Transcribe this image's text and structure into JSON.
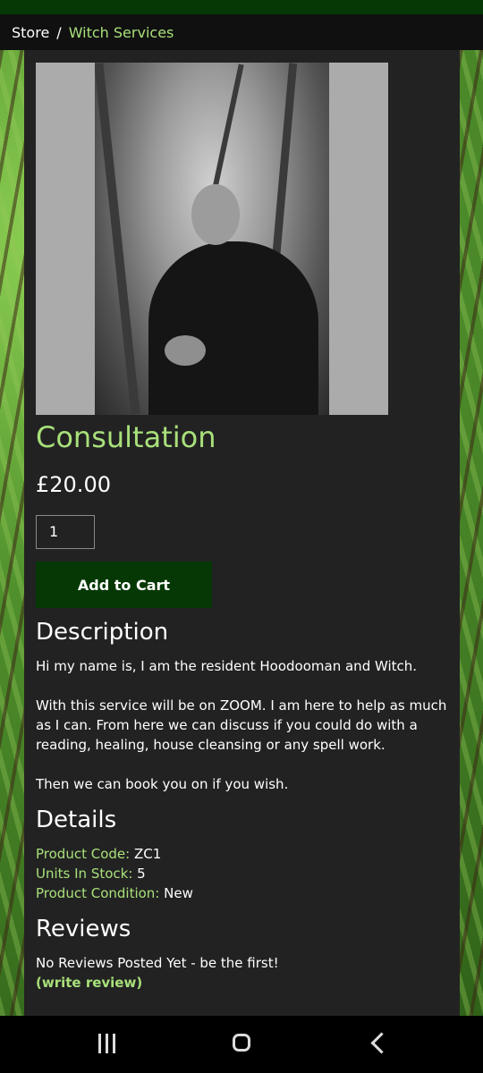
{
  "breadcrumb": {
    "store": "Store",
    "separator": "/",
    "current": "Witch Services"
  },
  "product": {
    "title": "Consultation",
    "price": "£20.00",
    "quantity": "1",
    "add_to_cart_label": "Add to Cart",
    "image_alt": "man-in-black-cloak-photo"
  },
  "description": {
    "heading": "Description",
    "paragraphs": [
      "Hi my name is, I am the resident Hoodooman and Witch.",
      "With this service will be on ZOOM. I am here to help as much as I can. From here we can discuss if you could do with a reading, healing, house cleansing or any spell work.",
      "Then we can book you on if you wish."
    ]
  },
  "details": {
    "heading": "Details",
    "product_code_label": "Product Code:",
    "product_code": "ZC1",
    "units_label": "Units In Stock:",
    "units": "5",
    "condition_label": "Product Condition:",
    "condition": "New"
  },
  "reviews": {
    "heading": "Reviews",
    "empty_text": "No Reviews Posted Yet - be the first!",
    "write_link": "(write review)"
  },
  "colors": {
    "accent": "#a8e07a",
    "button_bg": "#053805",
    "panel_bg": "#222222"
  },
  "navbar": {
    "icons": [
      "recents-icon",
      "home-icon",
      "back-icon"
    ]
  }
}
